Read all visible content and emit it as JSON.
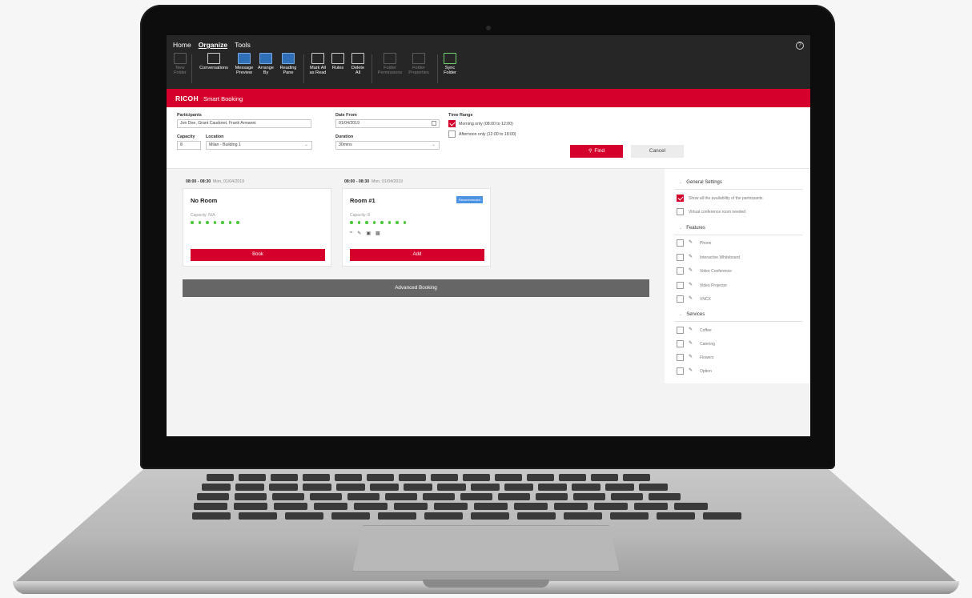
{
  "ribbon": {
    "tabs": [
      {
        "label": "Home"
      },
      {
        "label": "Organize"
      },
      {
        "label": "Tools"
      }
    ],
    "help_icon": "?",
    "buttons": [
      {
        "label": "New\nFolder"
      },
      {
        "label": "Conversations"
      },
      {
        "label": "Message\nPreview"
      },
      {
        "label": "Arrange\nBy"
      },
      {
        "label": "Reading\nPane"
      },
      {
        "label": "Mark All\nas Read"
      },
      {
        "label": "Rules"
      },
      {
        "label": "Delete\nAll"
      },
      {
        "label": "Folder\nPermissions"
      },
      {
        "label": "Folder\nProperties"
      },
      {
        "label": "Sync\nFolder"
      }
    ]
  },
  "brand": {
    "logo": "RICOH",
    "app_name": "Smart Booking",
    "accent_color": "#d4002b"
  },
  "form": {
    "participants_label": "Participants",
    "participants_value": "Jon Doe, Grant Caudoret, Frank Armanni",
    "date_from_label": "Date From",
    "date_from_value": "01/04/2019",
    "time_range_label": "Time Range",
    "time_range_morning": "Morning only (08:00 to 12:00)",
    "time_range_afternoon": "Afternoon only (12:00 to 18:00)",
    "capacity_label": "Capacity",
    "capacity_value": "8",
    "location_label": "Location",
    "location_value": "Milan - Building 1",
    "duration_label": "Duration",
    "duration_value": "30mins",
    "find_label": "Find",
    "cancel_label": "Cancel"
  },
  "results": [
    {
      "time": "08:00 - 08:30",
      "date": "Mon, 01/04/2019",
      "title": "No Room",
      "capacity": "Capacity: N/A",
      "badge": "",
      "button": "Book"
    },
    {
      "time": "08:00 - 08:30",
      "date": "Mon, 01/04/2019",
      "title": "Room #1",
      "capacity": "Capacity: 8",
      "badge": "Recommended",
      "button": "Add"
    }
  ],
  "advanced_booking_label": "Advanced Booking",
  "panel": {
    "general_title": "General Settings",
    "general_items": [
      "Show all the availability of the participants",
      "Virtual conference room needed"
    ],
    "features_title": "Features",
    "features_items": [
      "Phone",
      "Interactive Whiteboard",
      "Video Conference",
      "Video Projector",
      "VNCX"
    ],
    "services_title": "Services",
    "services_items": [
      "Coffee",
      "Catering",
      "Flowers",
      "Option"
    ]
  }
}
